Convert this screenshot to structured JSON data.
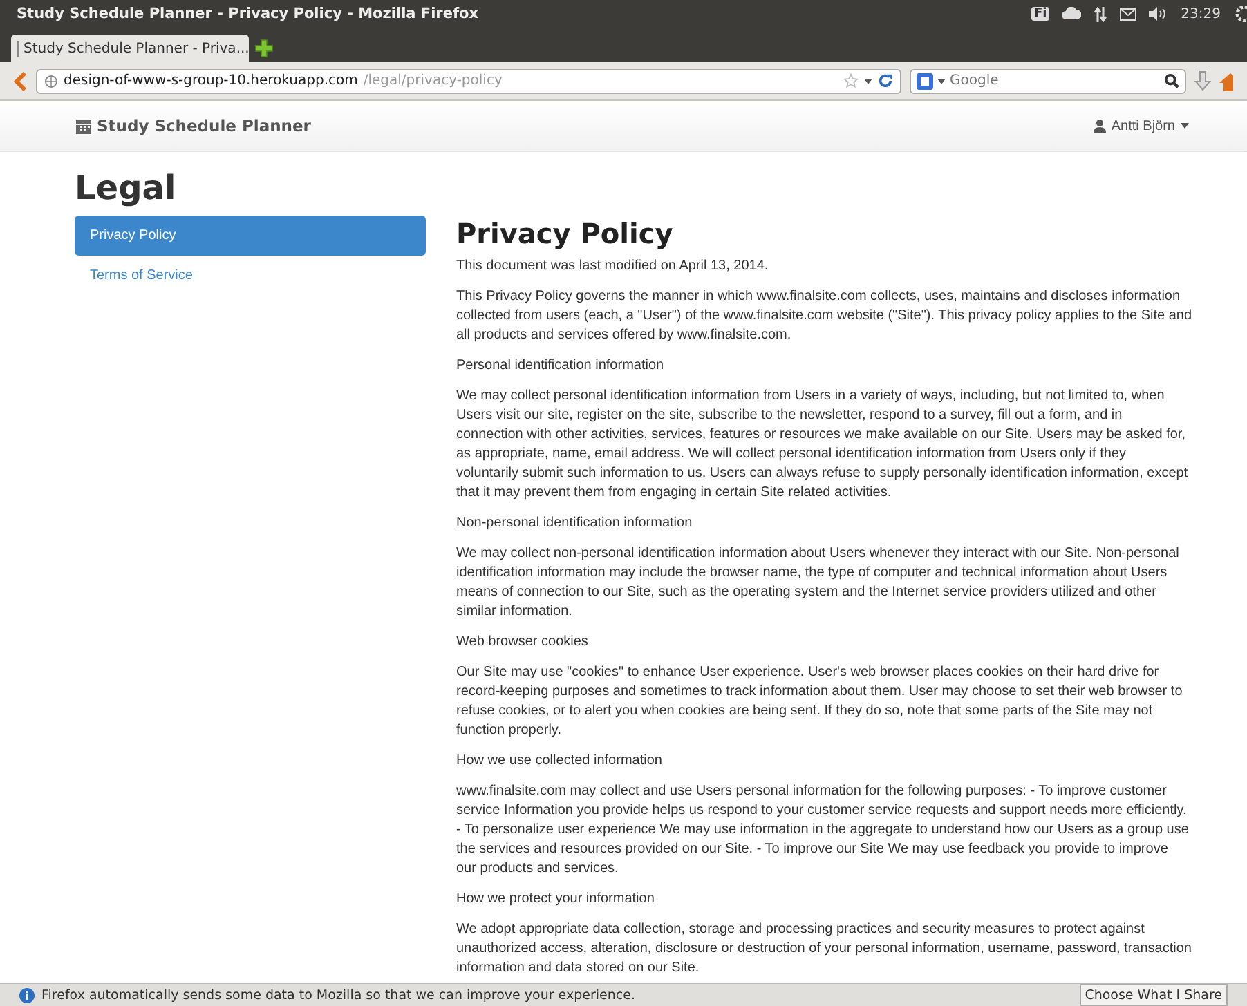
{
  "window": {
    "title": "Study Schedule Planner - Privacy Policy - Mozilla Firefox"
  },
  "tray": {
    "keyboard": "Fi",
    "time": "23:29"
  },
  "tabs": [
    {
      "label": "Study Schedule Planner - Priva...",
      "selected": true
    }
  ],
  "address_bar": {
    "host": "design-of-www-s-group-10.herokuapp.com",
    "path": "/legal/privacy-policy"
  },
  "search": {
    "placeholder": "Google"
  },
  "navbar": {
    "brand": "Study Schedule Planner",
    "user": "Antti Björn"
  },
  "page_title": "Legal",
  "sidebar": {
    "items": [
      {
        "label": "Privacy Policy",
        "selected": true
      },
      {
        "label": "Terms of Service",
        "selected": false
      }
    ]
  },
  "article": {
    "title": "Privacy Policy",
    "paragraphs": [
      "This document was last modified on April 13, 2014.",
      "This Privacy Policy governs the manner in which www.finalsite.com collects, uses, maintains and discloses information collected from users (each, a \"User\") of the www.finalsite.com website (\"Site\"). This privacy policy applies to the Site and all products and services offered by www.finalsite.com.",
      "Personal identification information",
      "We may collect personal identification information from Users in a variety of ways, including, but not limited to, when Users visit our site, register on the site, subscribe to the newsletter, respond to a survey, fill out a form, and in connection with other activities, services, features or resources we make available on our Site. Users may be asked for, as appropriate, name, email address. We will collect personal identification information from Users only if they voluntarily submit such information to us. Users can always refuse to supply personally identification information, except that it may prevent them from engaging in certain Site related activities.",
      "Non-personal identification information",
      "We may collect non-personal identification information about Users whenever they interact with our Site. Non-personal identification information may include the browser name, the type of computer and technical information about Users means of connection to our Site, such as the operating system and the Internet service providers utilized and other similar information.",
      "Web browser cookies",
      "Our Site may use \"cookies\" to enhance User experience. User's web browser places cookies on their hard drive for record-keeping purposes and sometimes to track information about them. User may choose to set their web browser to refuse cookies, or to alert you when cookies are being sent. If they do so, note that some parts of the Site may not function properly.",
      "How we use collected information",
      "www.finalsite.com may collect and use Users personal information for the following purposes: - To improve customer service Information you provide helps us respond to your customer service requests and support needs more efficiently. - To personalize user experience We may use information in the aggregate to understand how our Users as a group use the services and resources provided on our Site. - To improve our Site We may use feedback you provide to improve our products and services.",
      "How we protect your information",
      "We adopt appropriate data collection, storage and processing practices and security measures to protect against unauthorized access, alteration, disclosure or destruction of your personal information, username, password, transaction information and data stored on our Site."
    ]
  },
  "notification": {
    "message": "Firefox automatically sends some data to Mozilla so that we can improve your experience.",
    "button": "Choose What I Share"
  }
}
